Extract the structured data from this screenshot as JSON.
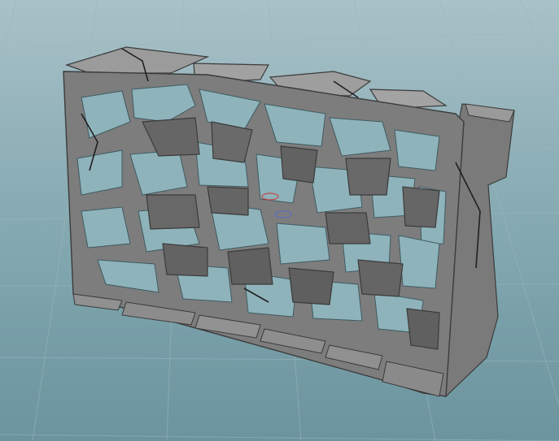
{
  "viewport": {
    "background_top": "#a9c1c8",
    "background_bottom": "#6c949e",
    "grid_color": "#9db6bd"
  },
  "model": {
    "description_icon": "fractured-wall-mesh",
    "face_color": "#6e6e6e",
    "light_color": "#8a8a8a",
    "edge_color": "#3b3b3b"
  },
  "pivot": {
    "color": "#c04a4a"
  }
}
